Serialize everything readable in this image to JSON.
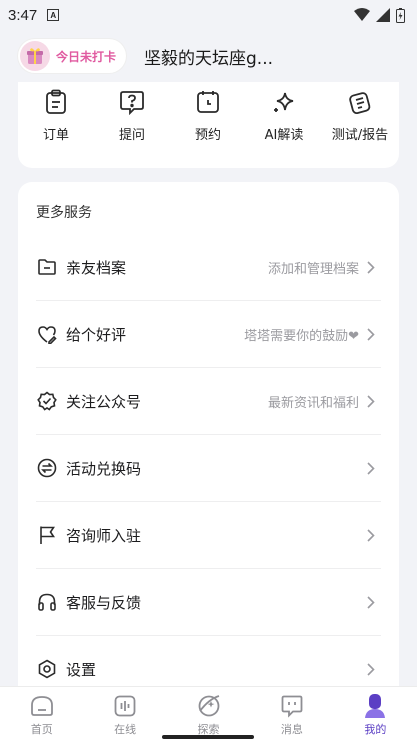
{
  "status_bar": {
    "time": "3:47",
    "notice_letter": "A"
  },
  "header": {
    "checkin_label": "今日未打卡",
    "username": "坚毅的天坛座g..."
  },
  "quick_actions": [
    {
      "icon": "clipboard-icon",
      "label": "订单"
    },
    {
      "icon": "question-bubble-icon",
      "label": "提问"
    },
    {
      "icon": "calendar-icon",
      "label": "预约"
    },
    {
      "icon": "sparkle-icon",
      "label": "AI解读"
    },
    {
      "icon": "test-report-icon",
      "label": "测试/报告"
    }
  ],
  "services": {
    "title": "更多服务",
    "items": [
      {
        "icon": "folder-icon",
        "label": "亲友档案",
        "hint": "添加和管理档案"
      },
      {
        "icon": "heart-edit-icon",
        "label": "给个好评",
        "hint": "塔塔需要你的鼓励❤"
      },
      {
        "icon": "badge-check-icon",
        "label": "关注公众号",
        "hint": "最新资讯和福利"
      },
      {
        "icon": "exchange-icon",
        "label": "活动兑换码",
        "hint": ""
      },
      {
        "icon": "flag-icon",
        "label": "咨询师入驻",
        "hint": ""
      },
      {
        "icon": "headset-icon",
        "label": "客服与反馈",
        "hint": ""
      },
      {
        "icon": "settings-icon",
        "label": "设置",
        "hint": ""
      }
    ]
  },
  "tabbar": {
    "tabs": [
      {
        "icon": "home-icon",
        "label": "首页",
        "active": false
      },
      {
        "icon": "live-icon",
        "label": "在线",
        "active": false
      },
      {
        "icon": "explore-icon",
        "label": "探索",
        "active": false
      },
      {
        "icon": "message-icon",
        "label": "消息",
        "active": false
      },
      {
        "icon": "profile-icon",
        "label": "我的",
        "active": true
      }
    ]
  },
  "colors": {
    "accent": "#5b3fc4",
    "checkin_pink": "#e05aa0",
    "background": "#f2f3f7"
  }
}
